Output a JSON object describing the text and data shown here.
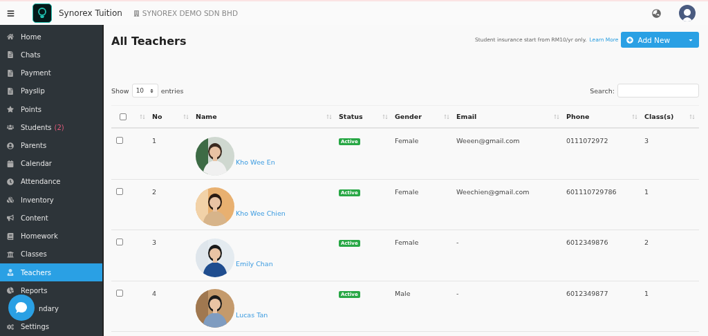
{
  "topbar": {
    "brand": "Synorex Tuition",
    "company": "SYNOREX DEMO SDN BHD"
  },
  "sidebar": {
    "items": [
      {
        "label": "Home",
        "selected": false,
        "kind": "link"
      },
      {
        "label": "Chats",
        "selected": false,
        "kind": "link"
      },
      {
        "label": "Payment",
        "selected": false,
        "kind": "link"
      },
      {
        "label": "Payslip",
        "selected": false,
        "kind": "link"
      },
      {
        "label": "Points",
        "selected": false,
        "kind": "link"
      },
      {
        "label": "Students",
        "badge": "(2)",
        "selected": false,
        "kind": "link"
      },
      {
        "label": "Parents",
        "selected": false,
        "kind": "link"
      },
      {
        "label": "Calendar",
        "selected": false,
        "kind": "link"
      },
      {
        "label": "Attendance",
        "selected": false,
        "kind": "link"
      },
      {
        "label": "Inventory",
        "selected": false,
        "kind": "link"
      },
      {
        "label": "Content",
        "selected": false,
        "kind": "link"
      },
      {
        "label": "Homework",
        "selected": false,
        "kind": "link"
      },
      {
        "label": "Classes",
        "selected": false,
        "kind": "link"
      },
      {
        "label": "Teachers",
        "selected": true,
        "kind": "link"
      },
      {
        "label": "Reports",
        "selected": false,
        "kind": "link"
      },
      {
        "label": "ndary",
        "selected": false,
        "kind": "covered"
      },
      {
        "label": "Settings",
        "selected": false,
        "kind": "link"
      }
    ]
  },
  "page": {
    "title": "All Teachers",
    "notice": "Student insurance start from RM10/yr only.",
    "notice_link": "Learn More",
    "add_button": "Add New"
  },
  "table_controls": {
    "show_label": "Show",
    "page_size": "10",
    "entries_label": "entries",
    "search_label": "Search:"
  },
  "table": {
    "select_all_checked": false,
    "columns": [
      "No",
      "Name",
      "Status",
      "Gender",
      "Email",
      "Phone",
      "Class(s)"
    ],
    "rows": [
      {
        "checked": false,
        "no": "1",
        "name": "Kho Wee En",
        "status": "Active",
        "gender": "Female",
        "email": "Weeen@gmail.com",
        "phone": "0111072972",
        "classes": "3"
      },
      {
        "checked": false,
        "no": "2",
        "name": "Kho Wee Chien",
        "status": "Active",
        "gender": "Female",
        "email": "Weechien@gmail.com",
        "phone": "601110729786",
        "classes": "1"
      },
      {
        "checked": false,
        "no": "3",
        "name": "Emily Chan",
        "status": "Active",
        "gender": "Female",
        "email": "-",
        "phone": "6012349876",
        "classes": "2"
      },
      {
        "checked": false,
        "no": "4",
        "name": "Lucas Tan",
        "status": "Active",
        "gender": "Male",
        "email": "-",
        "phone": "6012349877",
        "classes": "1"
      }
    ]
  }
}
